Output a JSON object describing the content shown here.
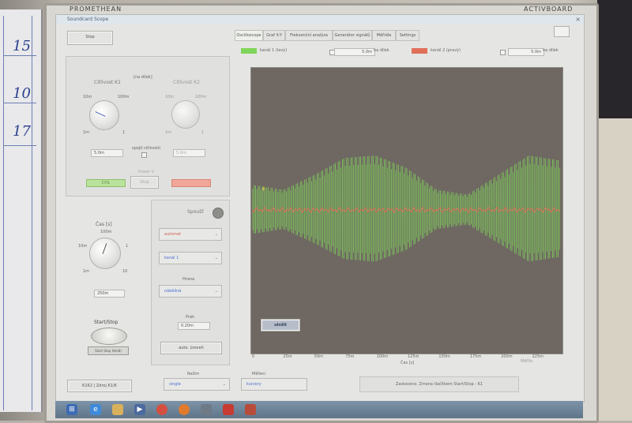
{
  "brand": {
    "left": "PROMETHEAN",
    "right": "ACTIVBOARD"
  },
  "whiteboard": {
    "numbers": [
      "15",
      "10",
      "17"
    ]
  },
  "app": {
    "title": "Soundcard Scope",
    "close": "×",
    "tabs": [
      "Oscilloscope",
      "Graf X-Y",
      "Frekvenční analýza",
      "Generátor signálů",
      "Měřidla",
      "Settings"
    ],
    "left": {
      "top_button": "Stop",
      "sens_ch1_label": "Citlivost K1",
      "sens_mode": "[na dílek]",
      "sens_ch2_label": "Citlivost K2",
      "knob1_scale": {
        "top_left": "10m",
        "top_right": "100m",
        "bottom_left": "1m",
        "bottom_right": "1"
      },
      "knob2_scale": {
        "top_left": "10m",
        "top_right": "100m",
        "bottom_left": "1m",
        "bottom_right": "1"
      },
      "ch1_value": "5.0m",
      "ch2_value": "5.0m",
      "sync_label": "spojit citlivosti",
      "power_label": "Power V",
      "power_button": "Stop",
      "ch1_indicator": "CH1",
      "time_label": "Čas [s]",
      "time_scale": {
        "top_left": "10m",
        "top_mid": "100m",
        "top_right": "1",
        "bottom_left": "1m",
        "bottom_right": "10"
      },
      "time_value": "250m",
      "trigger_label": "Start/Stop",
      "trigger_sub": "Start Stop (Hold)",
      "status_box": "K1K2 | Zdroj K1/K"
    },
    "mid": {
      "spoust_label": "Spoušť",
      "mode_dd": "automat",
      "channel_dd": "kanál 1",
      "hrana_label": "Hrana",
      "edge_dd": "náběžná",
      "prah_label": "Práh",
      "prah_value": "0.20m",
      "auto_button": "auto. úroveň",
      "rezim_label": "Režim",
      "rezim_dd": "single",
      "merici_label": "Měření",
      "merici_value": "kurzory"
    },
    "top_channels": {
      "ch1_label": "kanál 1 (levý)",
      "ch1_div": "5.0m",
      "ch1_unit": "na dílek",
      "ch2_label": "kanál 2 (pravý)",
      "ch2_div": "5.0m",
      "ch2_unit": "na dílek",
      "ch1_color": "#7fd45a",
      "ch2_color": "#e0705a"
    },
    "plot": {
      "button": "uložit",
      "x_ticks": [
        "0",
        "25m",
        "50m",
        "75m",
        "100m",
        "125m",
        "150m",
        "175m",
        "200m",
        "225m"
      ],
      "x_label": "Čas [s]",
      "corner_note": "Měřilo",
      "background": "#6f6862"
    },
    "status_bar": "Zastaveno. Zmena tlačítkem Start/Stop - K1"
  },
  "chart_data": {
    "type": "line",
    "x_ticks": [
      "0",
      "25m",
      "50m",
      "75m",
      "100m",
      "125m",
      "150m",
      "175m",
      "200m",
      "225m"
    ],
    "xlabel": "Čas [s]",
    "series": [
      {
        "name": "kanál 1 (levý)",
        "color": "#7fd45a",
        "envelope": [
          0.35,
          0.25,
          0.55,
          0.9,
          0.95,
          0.7,
          0.25,
          0.15,
          0.55,
          0.95,
          0.85
        ]
      },
      {
        "name": "kanál 2 (pravý)",
        "color": "#e0705a",
        "envelope": [
          0.02,
          0.02,
          0.02,
          0.02,
          0.02,
          0.02,
          0.02,
          0.02,
          0.02,
          0.02,
          0.02
        ]
      }
    ]
  }
}
